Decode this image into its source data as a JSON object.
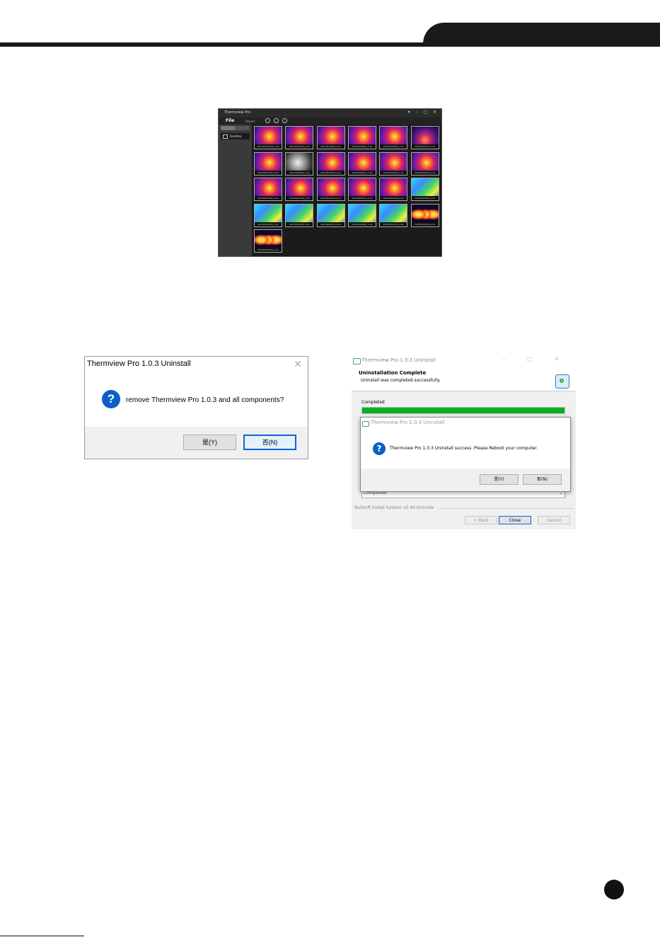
{
  "app": {
    "title": "Thermview Pro",
    "window_controls": "▾ – □ ✕",
    "menu_file": "File",
    "menu_report": "Report",
    "sidebar_item": "Desktop",
    "thumbnails": [
      {
        "caption": "20210924040A_A.he",
        "palette": "iron"
      },
      {
        "caption": "20210914063_A.he",
        "palette": "iron"
      },
      {
        "caption": "20210914062_A.he",
        "palette": "iron"
      },
      {
        "caption": "20210910060_A.he",
        "palette": "iron"
      },
      {
        "caption": "20210910052_A.he",
        "palette": "iron"
      },
      {
        "caption": "20210921011_A.he",
        "palette": "iron-dark"
      },
      {
        "caption": "20210921010_A.he",
        "palette": "iron"
      },
      {
        "caption": "20210910050_A.he",
        "palette": "gray"
      },
      {
        "caption": "20210910049_A.he",
        "palette": "iron"
      },
      {
        "caption": "20210910047_A.he",
        "palette": "iron"
      },
      {
        "caption": "20210910045_A.he",
        "palette": "iron"
      },
      {
        "caption": "20210910044_A.he",
        "palette": "iron"
      },
      {
        "caption": "20210921004_A.he",
        "palette": "iron"
      },
      {
        "caption": "20210921003_A.he",
        "palette": "iron"
      },
      {
        "caption": "20210921002_A.he",
        "palette": "iron"
      },
      {
        "caption": "20210921001_A.he",
        "palette": "iron"
      },
      {
        "caption": "20210921000_A.he",
        "palette": "iron"
      },
      {
        "caption": "20210921004_A.he",
        "palette": "rainbow"
      },
      {
        "caption": "20210921003_A.he",
        "palette": "rainbow"
      },
      {
        "caption": "20210921002_A.he",
        "palette": "rainbow"
      },
      {
        "caption": "20210921001_A.he",
        "palette": "rainbow"
      },
      {
        "caption": "20210921000_A.he",
        "palette": "rainbow"
      },
      {
        "caption": "20210921021_A.he",
        "palette": "rainbow"
      },
      {
        "caption": "20210921020_A.he",
        "palette": "bulbs"
      },
      {
        "caption": "20210921019_A.he",
        "palette": "bulbs"
      }
    ]
  },
  "dialog1": {
    "title": "Thermview Pro 1.0.3 Uninstall",
    "close": "✕",
    "icon": "question-icon",
    "message": "remove Thermview Pro 1.0.3 and all components?",
    "yes_label": "是(Y)",
    "no_label": "否(N)"
  },
  "nsis": {
    "title": "Thermview Pro 1.0.3 Uninstall",
    "controls": "– □ ✕",
    "header_title": "Uninstallation Complete",
    "header_subtitle": "Uninstall was completed successfully.",
    "status_label": "Completed",
    "progress": 1.0,
    "detail_value": "Completed",
    "branding": "Nullsoft Install System v2.46-Unicode",
    "back_label": "< Back",
    "close_label": "Close",
    "cancel_label": "Cancel",
    "progress_color": "#06b025"
  },
  "dialog2": {
    "title": "Thermview Pro 1.0.3 Uninstall",
    "icon": "question-icon",
    "message": "Thermview Pro 1.0.3 Uninstall success. Please Reboot your computer.",
    "yes_label": "是(Y)",
    "no_label": "否(N)"
  }
}
